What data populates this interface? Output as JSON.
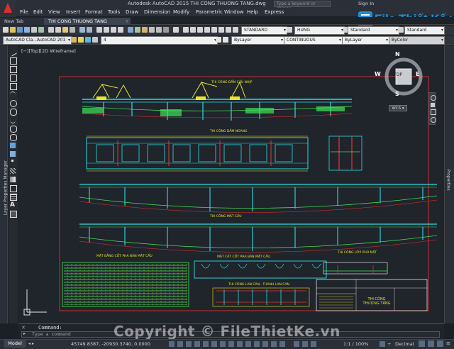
{
  "app": {
    "title": "Autodesk AutoCAD 2015    THI CONG THUONG TANG.dwg",
    "search_placeholder": "Type a keyword or phrase",
    "sign_in": "Sign In"
  },
  "menu": [
    "File",
    "Edit",
    "View",
    "Insert",
    "Format",
    "Tools",
    "Draw",
    "Dimension",
    "Modify",
    "Parametric",
    "Window",
    "Help",
    "Express"
  ],
  "tabs": [
    {
      "label": "New Tab"
    },
    {
      "label": "THI CONG THUONG TANG"
    }
  ],
  "toolbar": {
    "text_style": "STANDARD",
    "dim_style": "HUNG",
    "table_style": "Standard",
    "multileader_style": "Standard",
    "workspace": "AutoCAD Cla...AutoCAD 201",
    "layer": "4",
    "color": "ByLayer",
    "linetype": "CONTINUOUS",
    "lineweight": "ByLayer",
    "plotstyle": "ByColor"
  },
  "palettes": {
    "left_label": "Layer Properties Manager",
    "right_label": "Properties"
  },
  "viewport": {
    "label": "[−][Top][2D Wireframe]",
    "viewcube": {
      "n": "N",
      "s": "S",
      "e": "E",
      "w": "W",
      "face": "TOP",
      "ucs": "WCS"
    }
  },
  "drawing_labels": {
    "title1": "THI CÔNG DẦM CẦU NHỊP",
    "title2": "THI CÔNG DẦM NGANG",
    "title3": "THI CÔNG MẶT CẦU",
    "title4": "MẶT BẰNG CỐT PHA BẢN MẶT CẦU",
    "title5": "MẶT CẮT CỐT PHA BẢN MẶT CẦU",
    "title6": "THI CÔNG LAN CAN - THANH LAN CAN",
    "title7": "THI CÔNG LỚP PHỦ MẶT",
    "stamp": "THI CÔNG THƯỢNG TẦNG"
  },
  "command": {
    "history": "Command:",
    "placeholder": "Type a command"
  },
  "status": {
    "model": "Model",
    "coords": "45749.8387, -20930.3740, 0.0000",
    "scale": "1:1 / 100%",
    "units": "Decimal"
  },
  "branding": {
    "logo_text": "File Thiết Kế.vn",
    "watermark": "Copyright © FileThietKe.vn"
  },
  "colors": {
    "drawing_bg": "#20242b",
    "cyan": "#27e1e6",
    "green": "#3fe35a",
    "yellow": "#e8e62a",
    "red": "#e33",
    "white": "#ffffff",
    "brand_blue": "#1e8fd6",
    "brand_orange": "#f07a1a"
  }
}
